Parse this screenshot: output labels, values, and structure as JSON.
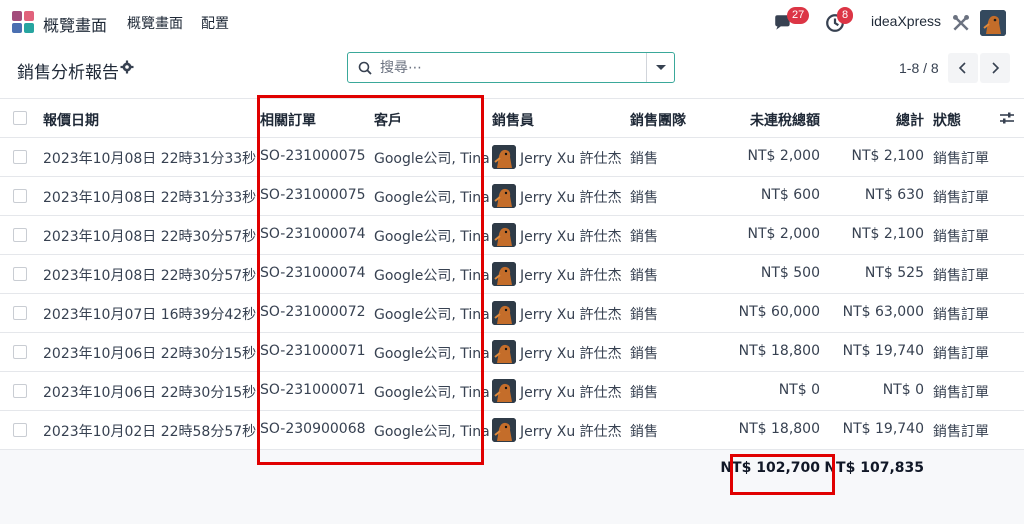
{
  "nav": {
    "brand": "概覽畫面",
    "menu": [
      "概覽畫面",
      "配置"
    ],
    "messages_count": "27",
    "activities_count": "8",
    "company": "ideaXpress"
  },
  "control": {
    "title": "銷售分析報告",
    "search_placeholder": "搜尋⋯",
    "pager": "1-8 / 8"
  },
  "columns": [
    "報價日期",
    "相關訂單",
    "客戶",
    "銷售員",
    "銷售團隊",
    "未連稅總額",
    "總計",
    "狀態"
  ],
  "rows": [
    {
      "date": "2023年10月08日 22時31分33秒",
      "order": "SO-231000075",
      "customer": "Google公司, Tina",
      "salesperson": "Jerry Xu 許仕杰",
      "team": "銷售",
      "untaxed": "NT$ 2,000",
      "total": "NT$ 2,100",
      "status": "銷售訂單"
    },
    {
      "date": "2023年10月08日 22時31分33秒",
      "order": "SO-231000075",
      "customer": "Google公司, Tina",
      "salesperson": "Jerry Xu 許仕杰",
      "team": "銷售",
      "untaxed": "NT$ 600",
      "total": "NT$ 630",
      "status": "銷售訂單"
    },
    {
      "date": "2023年10月08日 22時30分57秒",
      "order": "SO-231000074",
      "customer": "Google公司, Tina",
      "salesperson": "Jerry Xu 許仕杰",
      "team": "銷售",
      "untaxed": "NT$ 2,000",
      "total": "NT$ 2,100",
      "status": "銷售訂單"
    },
    {
      "date": "2023年10月08日 22時30分57秒",
      "order": "SO-231000074",
      "customer": "Google公司, Tina",
      "salesperson": "Jerry Xu 許仕杰",
      "team": "銷售",
      "untaxed": "NT$ 500",
      "total": "NT$ 525",
      "status": "銷售訂單"
    },
    {
      "date": "2023年10月07日 16時39分42秒",
      "order": "SO-231000072",
      "customer": "Google公司, Tina",
      "salesperson": "Jerry Xu 許仕杰",
      "team": "銷售",
      "untaxed": "NT$ 60,000",
      "total": "NT$ 63,000",
      "status": "銷售訂單"
    },
    {
      "date": "2023年10月06日 22時30分15秒",
      "order": "SO-231000071",
      "customer": "Google公司, Tina",
      "salesperson": "Jerry Xu 許仕杰",
      "team": "銷售",
      "untaxed": "NT$ 18,800",
      "total": "NT$ 19,740",
      "status": "銷售訂單"
    },
    {
      "date": "2023年10月06日 22時30分15秒",
      "order": "SO-231000071",
      "customer": "Google公司, Tina",
      "salesperson": "Jerry Xu 許仕杰",
      "team": "銷售",
      "untaxed": "NT$ 0",
      "total": "NT$ 0",
      "status": "銷售訂單"
    },
    {
      "date": "2023年10月02日 22時58分57秒",
      "order": "SO-230900068",
      "customer": "Google公司, Tina",
      "salesperson": "Jerry Xu 許仕杰",
      "team": "銷售",
      "untaxed": "NT$ 18,800",
      "total": "NT$ 19,740",
      "status": "銷售訂單"
    }
  ],
  "totals": {
    "untaxed": "NT$ 102,700",
    "total": "NT$ 107,835"
  },
  "colors": {
    "accent": "#3aa89a",
    "badge": "#dc3545",
    "highlight": "#e00000"
  },
  "icons": {
    "app": "app-grid-icon",
    "messages": "chat-icon",
    "activities": "clock-icon",
    "debug": "tools-icon",
    "settings": "gear-icon",
    "search": "search-icon",
    "optional_columns": "sliders-icon"
  }
}
